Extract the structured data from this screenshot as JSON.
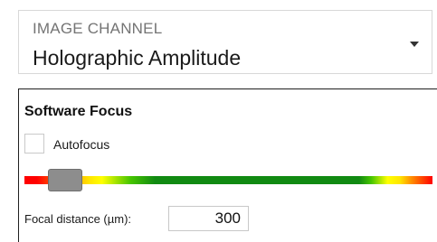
{
  "image_channel": {
    "label": "IMAGE CHANNEL",
    "value": "Holographic Amplitude",
    "arrow_icon": "dropdown-arrow-icon"
  },
  "software_focus": {
    "title": "Software Focus",
    "autofocus": {
      "label": "Autofocus",
      "checked": false
    },
    "slider": {
      "position_percent": 12,
      "colors": [
        "#ff0000",
        "#ff8a00",
        "#ffe600",
        "#ffff00",
        "#46c500",
        "#118a12"
      ]
    },
    "focal_distance": {
      "label": "Focal distance (µm):",
      "value": "300"
    }
  }
}
